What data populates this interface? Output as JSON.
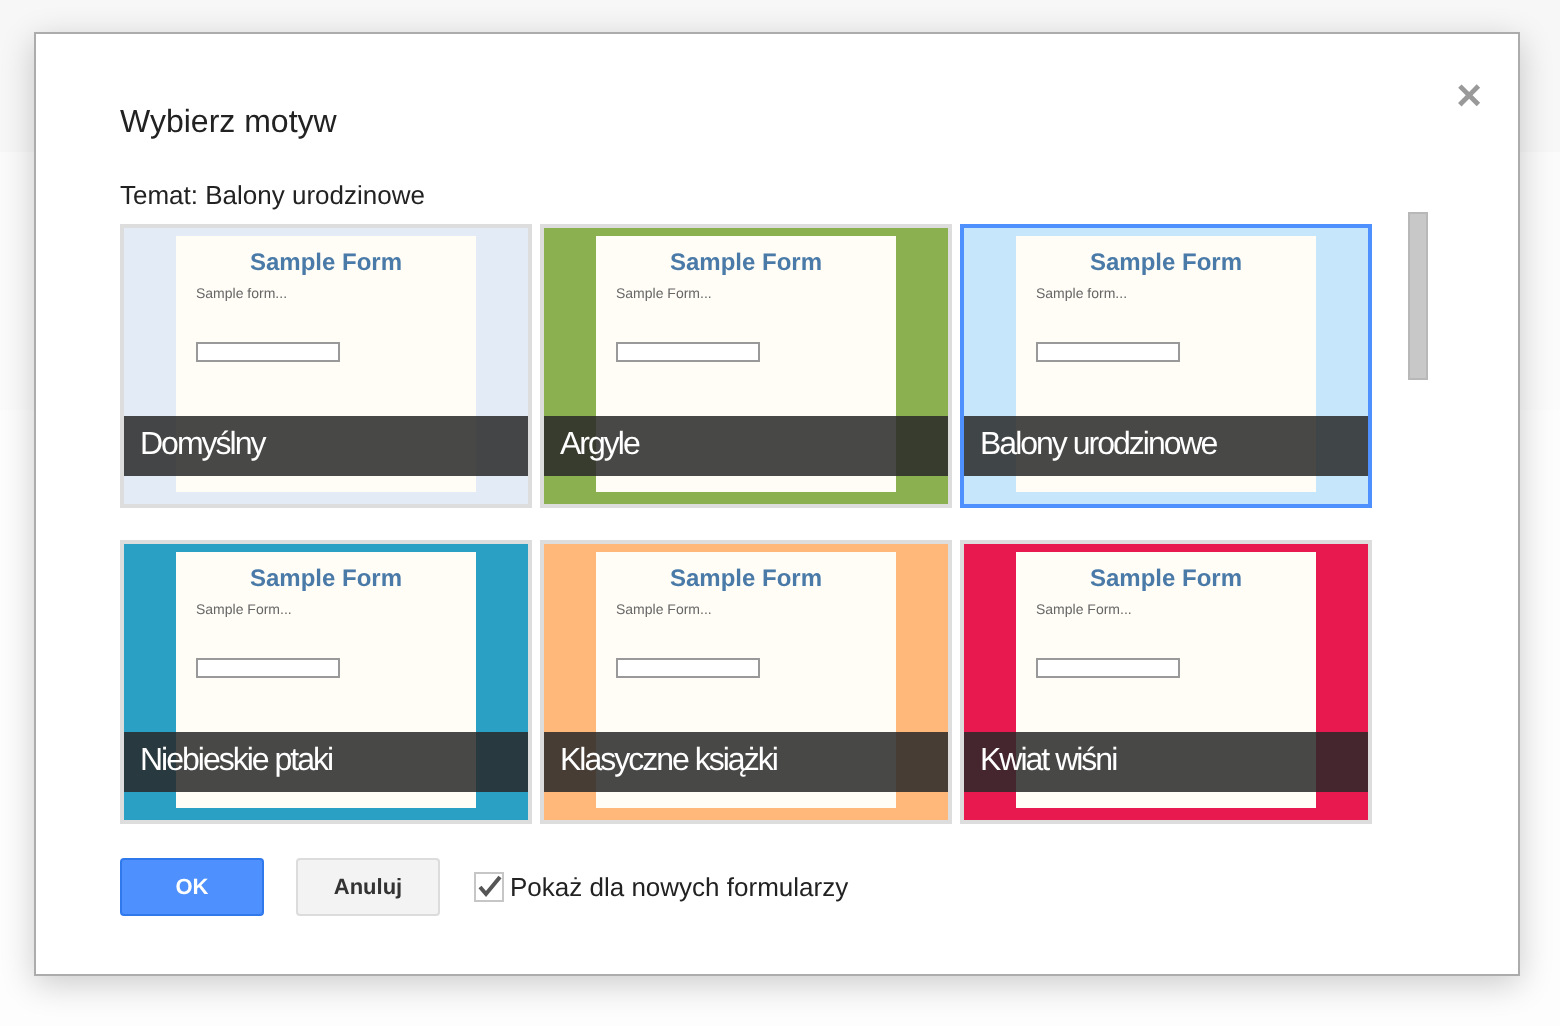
{
  "dialog": {
    "title": "Wybierz motyw",
    "close": "×",
    "current_theme": "Temat: Balony urodzinowe",
    "themes": [
      {
        "name": "Domyślny",
        "selected": false,
        "color": "#e3ebf7",
        "preview_title": "Sample Form",
        "preview_subtitle": "Sample form..."
      },
      {
        "name": "Argyle",
        "selected": false,
        "color": "#8bb04f",
        "preview_title": "Sample Form",
        "preview_subtitle": "Sample Form..."
      },
      {
        "name": "Balony urodzinowe",
        "selected": true,
        "color": "#c5e6fb",
        "preview_title": "Sample Form",
        "preview_subtitle": "Sample form..."
      },
      {
        "name": "Niebieskie ptaki",
        "selected": false,
        "color": "#2aa0c4",
        "preview_title": "Sample Form",
        "preview_subtitle": "Sample Form..."
      },
      {
        "name": "Klasyczne książki",
        "selected": false,
        "color": "#ffb77a",
        "preview_title": "Sample Form",
        "preview_subtitle": "Sample Form..."
      },
      {
        "name": "Kwiat wiśni",
        "selected": false,
        "color": "#e8194f",
        "preview_title": "Sample Form",
        "preview_subtitle": "Sample Form..."
      }
    ],
    "ok_button": "OK",
    "cancel_button": "Anuluj",
    "show_for_new": {
      "label": "Pokaż dla nowych formularzy",
      "checked": true
    }
  }
}
